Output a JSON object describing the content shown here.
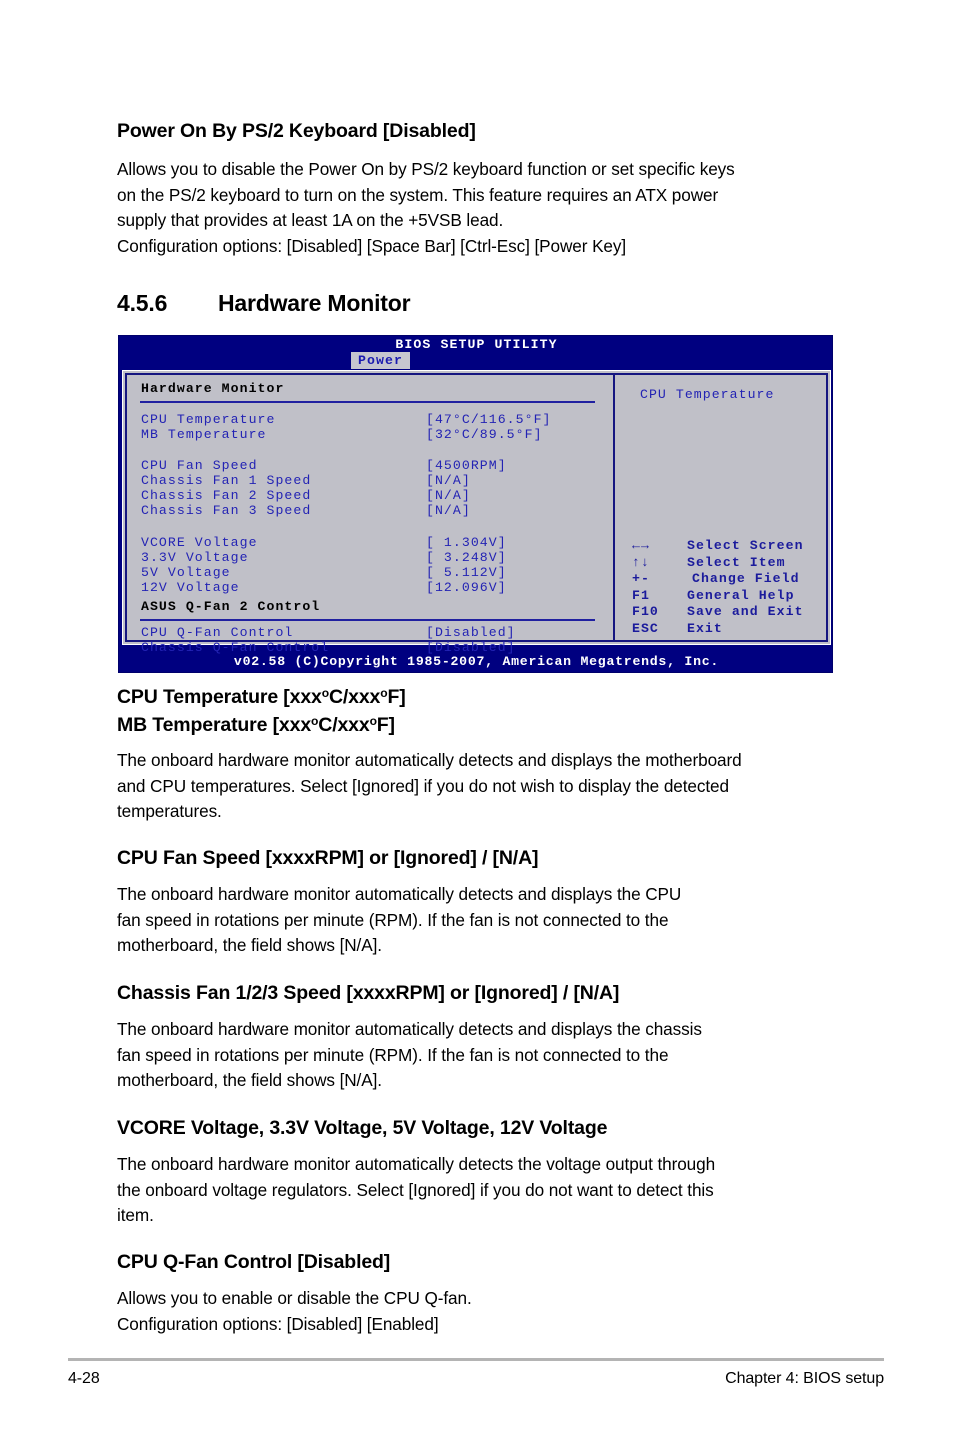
{
  "sections": {
    "power_on_ps2": {
      "heading": "Power On By PS/2 Keyboard [Disabled]",
      "lines": [
        "Allows you to disable the Power On by PS/2 keyboard function or set specific keys",
        "on the PS/2 keyboard to turn on the system. This feature requires an ATX power",
        "supply that provides at least 1A on the +5VSB lead.",
        "Configuration options: [Disabled] [Space Bar] [Ctrl-Esc] [Power Key]"
      ]
    },
    "hardware_monitor": {
      "number": "4.5.6",
      "title": "Hardware Monitor"
    },
    "temperature": {
      "heading_line1_a": "CPU Temperature [xxx",
      "heading_line1_b": "C/xxx",
      "heading_line1_c": "F]",
      "heading_line2_a": "MB Temperature [xxx",
      "heading_line2_b": "C/xxx",
      "heading_line2_c": "F]",
      "deg": "o",
      "lines": [
        "The onboard hardware monitor automatically detects and displays the motherboard",
        "and CPU temperatures. Select [Ignored] if you do not wish to display the detected",
        "temperatures."
      ]
    },
    "cpu_fan_speed": {
      "heading": "CPU Fan Speed [xxxxRPM] or [Ignored] / [N/A]",
      "lines": [
        "The onboard hardware monitor automatically detects and displays the CPU",
        "fan speed in rotations per minute (RPM). If the fan is not connected to the",
        "motherboard, the field shows [N/A]."
      ]
    },
    "chassis_fan_speed": {
      "heading": "Chassis Fan 1/2/3 Speed [xxxxRPM] or [Ignored] / [N/A]",
      "lines": [
        "The onboard hardware monitor automatically detects and displays the chassis",
        "fan speed in rotations per minute (RPM). If the fan is not connected to the",
        "motherboard, the field shows [N/A]."
      ]
    },
    "voltage": {
      "heading": "VCORE Voltage, 3.3V Voltage, 5V Voltage, 12V Voltage",
      "lines": [
        "The onboard hardware monitor automatically detects the voltage output through",
        "the onboard voltage regulators. Select [Ignored] if you do not want to detect this",
        "item."
      ]
    },
    "cpu_qfan": {
      "heading": "CPU Q-Fan Control [Disabled]",
      "lines": [
        "Allows you to enable or disable the CPU Q-fan.",
        "Configuration options: [Disabled] [Enabled]"
      ]
    }
  },
  "bios": {
    "title": "BIOS SETUP UTILITY",
    "active_tab": "Power",
    "panel_heading": "Hardware Monitor",
    "section_heading": "ASUS Q-Fan 2 Control",
    "help_title": "CPU Temperature",
    "footer": "v02.58 (C)Copyright 1985-2007, American Megatrends, Inc.",
    "rows_temp": [
      {
        "label": "CPU Temperature",
        "value": "[47°C/116.5°F]"
      },
      {
        "label": "MB Temperature",
        "value": "[32°C/89.5°F]"
      }
    ],
    "rows_fan": [
      {
        "label": "CPU Fan Speed",
        "value": "[4500RPM]"
      },
      {
        "label": "Chassis Fan 1 Speed",
        "value": "[N/A]"
      },
      {
        "label": "Chassis Fan 2 Speed",
        "value": "[N/A]"
      },
      {
        "label": "Chassis Fan 3 Speed",
        "value": "[N/A]"
      }
    ],
    "rows_voltage": [
      {
        "label": "VCORE Voltage",
        "value": "[ 1.304V]"
      },
      {
        "label": "3.3V  Voltage",
        "value": "[ 3.248V]"
      },
      {
        "label": "5V    Voltage",
        "value": "[ 5.112V]"
      },
      {
        "label": "12V   Voltage",
        "value": "[12.096V]"
      }
    ],
    "rows_qfan": [
      {
        "label": "CPU Q-Fan Control",
        "value": "[Disabled]"
      },
      {
        "label": "Chassis Q-Fan Control",
        "value": "[Disabled]"
      }
    ],
    "keys": [
      {
        "key": "←→",
        "desc": "Select Screen"
      },
      {
        "key": "↑↓",
        "desc": "Select Item"
      },
      {
        "key": "+-",
        "desc": "Change Field"
      },
      {
        "key": "F1",
        "desc": "General Help"
      },
      {
        "key": "F10",
        "desc": "Save and Exit"
      },
      {
        "key": "ESC",
        "desc": "Exit"
      }
    ],
    "colors": {
      "chrome_blue": "#000080",
      "panel_gray": "#c0c0c8",
      "text_blue": "#2323b4",
      "tab_bg": "#c7c7cf"
    }
  },
  "footer": {
    "page_number": "4-28",
    "chapter": "Chapter 4: BIOS setup"
  }
}
